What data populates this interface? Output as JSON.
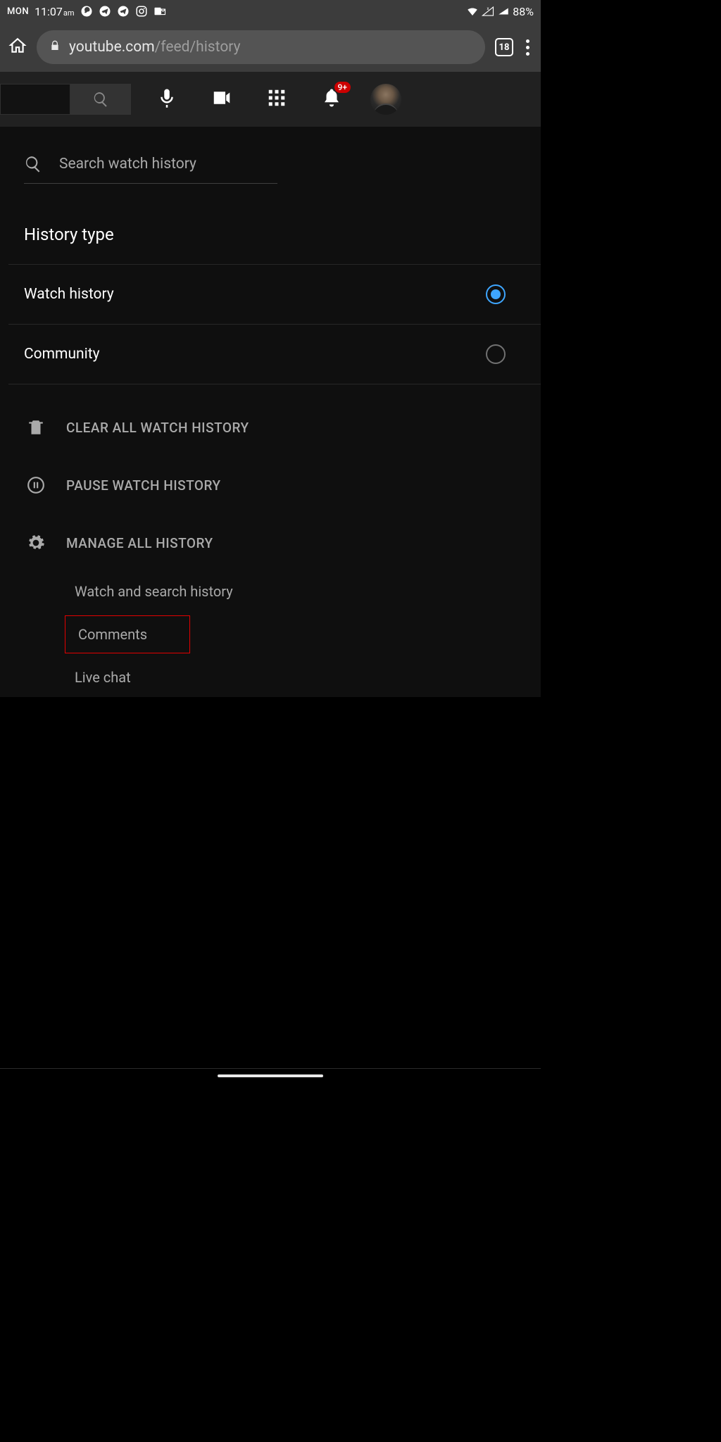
{
  "status": {
    "day": "MON",
    "time": "11:07",
    "ampm": "am",
    "battery": "88%"
  },
  "browser": {
    "url_host": "youtube.com",
    "url_path": "/feed/history",
    "tab_count": "18"
  },
  "yt_header": {
    "notification_badge": "9+"
  },
  "search": {
    "placeholder": "Search watch history"
  },
  "history_type": {
    "title": "History type",
    "options": [
      {
        "label": "Watch history",
        "selected": true
      },
      {
        "label": "Community",
        "selected": false
      }
    ]
  },
  "actions": {
    "clear": "CLEAR ALL WATCH HISTORY",
    "pause": "PAUSE WATCH HISTORY",
    "manage": "MANAGE ALL HISTORY",
    "sublinks": [
      "Watch and search history",
      "Comments",
      "Live chat"
    ]
  }
}
